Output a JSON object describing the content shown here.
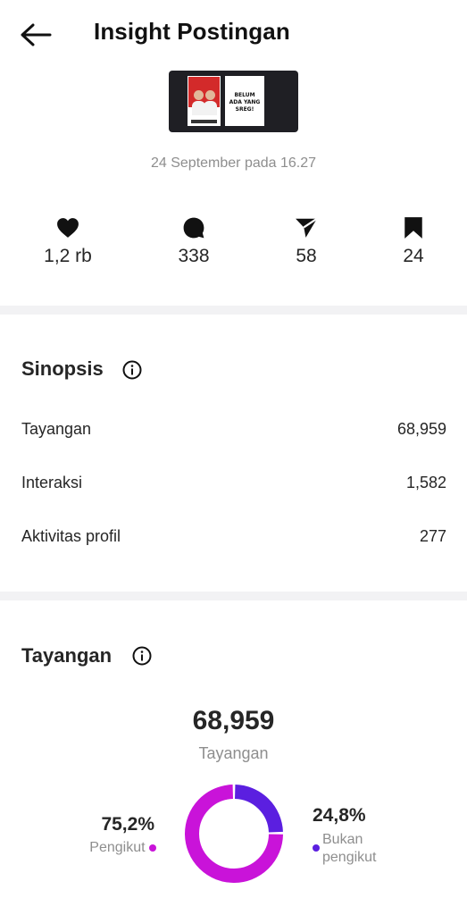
{
  "header": {
    "title": "Insight Postingan",
    "back_icon": "arrow-left-icon"
  },
  "post": {
    "date": "24 September pada 16.27",
    "thumbnail_card_text": "BELUM ADA YANG SREG!"
  },
  "stats": [
    {
      "icon": "heart-icon",
      "value": "1,2 rb"
    },
    {
      "icon": "comment-icon",
      "value": "338"
    },
    {
      "icon": "share-icon",
      "value": "58"
    },
    {
      "icon": "bookmark-icon",
      "value": "24"
    }
  ],
  "sinopsis": {
    "title": "Sinopsis",
    "rows": [
      {
        "label": "Tayangan",
        "value": "68,959"
      },
      {
        "label": "Interaksi",
        "value": "1,582"
      },
      {
        "label": "Aktivitas profil",
        "value": "277"
      }
    ]
  },
  "tayangan": {
    "title": "Tayangan",
    "total": "68,959",
    "total_label": "Tayangan",
    "followers": {
      "percent": "75,2%",
      "label": "Pengikut",
      "fraction": 0.752,
      "color": "#c913d9"
    },
    "non_followers": {
      "percent": "24,8%",
      "label": "Bukan pengikut",
      "fraction": 0.248,
      "color": "#5b1fe0"
    }
  }
}
